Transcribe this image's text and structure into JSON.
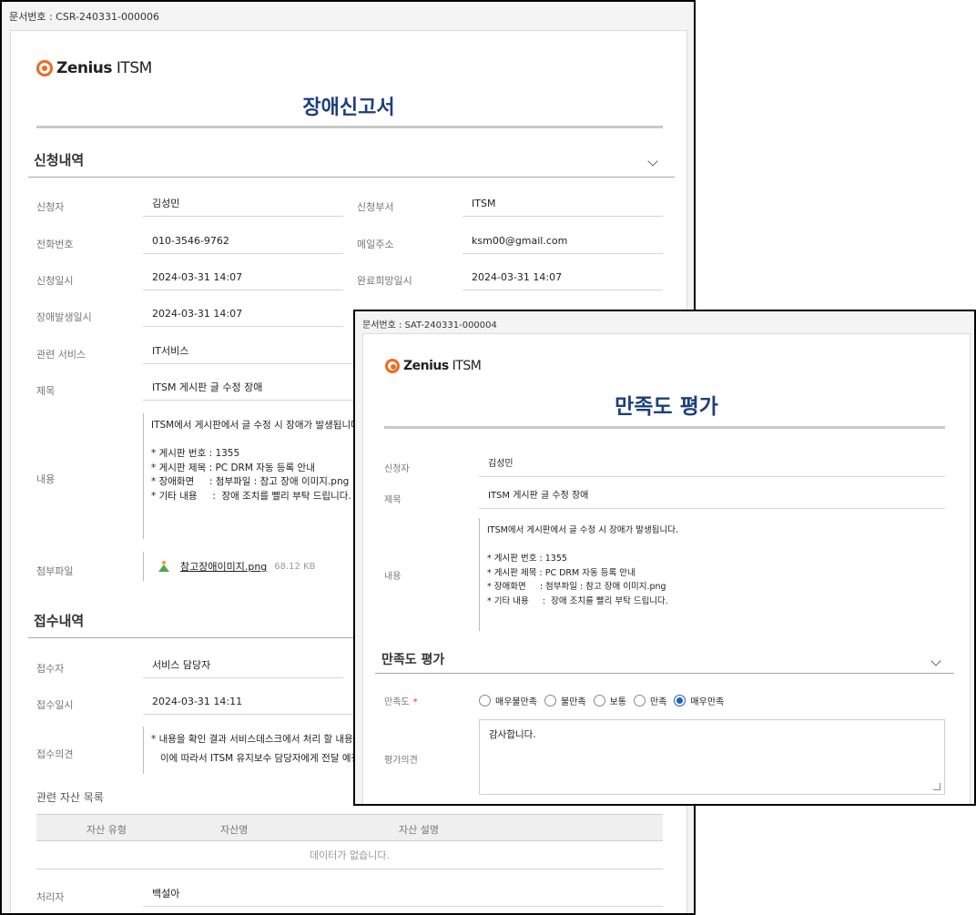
{
  "report": {
    "doc_no": "문서번호 : CSR-240331-000006",
    "logo": {
      "brand": "Zenius",
      "product": " ITSM"
    },
    "title": "장애신고서",
    "request_section": {
      "title": "신청내역",
      "requester_label": "신청자",
      "requester": "김성민",
      "dept_label": "신청부서",
      "dept": "ITSM",
      "phone_label": "전화번호",
      "phone": "010-3546-9762",
      "email_label": "메일주소",
      "email": "ksm00@gmail.com",
      "request_date_label": "신청일시",
      "request_date": "2024-03-31 14:07",
      "due_date_label": "완료희망일시",
      "due_date": "2024-03-31 14:07",
      "incident_date_label": "장애발생일시",
      "incident_date": "2024-03-31 14:07",
      "service_label": "관련 서비스",
      "service": "IT서비스",
      "subject_label": "제목",
      "subject": "ITSM 게시판 글 수정 장애",
      "content_label": "내용",
      "content": "ITSM에서 게시판에서 글 수정 시 장애가 발생됩니다.\n\n* 게시판 번호 : 1355\n* 게시판 제목 : PC DRM 자동 등록 안내\n* 장애화면     : 첨부파일 : 참고 장애 이미지.png\n* 기타 내용     :  장애 조치를 빨리 부탁 드립니다.",
      "attachment_label": "첨부파일",
      "attachment_name": "참고장애이미지.png",
      "attachment_size": "68.12 KB"
    },
    "receipt_section": {
      "title": "접수내역",
      "receiver_label": "접수자",
      "receiver": "서비스 담당자",
      "receipt_date_label": "접수일시",
      "receipt_date": "2024-03-31 14:11",
      "opinion_label": "접수의견",
      "opinion": "* 내용을 확인 결과 서비스데스크에서 처리 할 내용이\n   이에 따라서 ITSM 유지보수 담당자에게 전달 예정.",
      "assets_title": "관련 자산 목록",
      "asset_columns": [
        "자산 유형",
        "자산명",
        "자산 설명"
      ],
      "assets_empty": "데이터가 없습니다.",
      "handler_label": "처리자",
      "handler": "백설아"
    }
  },
  "survey": {
    "doc_no": "문서번호 : SAT-240331-000004",
    "logo": {
      "brand": "Zenius",
      "product": " ITSM"
    },
    "title": "만족도 평가",
    "requester_label": "신청자",
    "requester": "김성민",
    "subject_label": "제목",
    "subject": "ITSM 게시판 글 수정 장애",
    "content_label": "내용",
    "content": "ITSM에서 게시판에서 글 수정 시 장애가 발생됩니다.\n\n* 게시판 번호 : 1355\n* 게시판 제목 : PC DRM 자동 등록 안내\n* 장애화면     : 첨부파일 : 참고 장애 이미지.png\n* 기타 내용     :  장애 조치를 빨리 부탁 드립니다.",
    "eval_section": {
      "title": "만족도 평가",
      "rating_label": "만족도",
      "required_mark": "*",
      "options": [
        "매우불만족",
        "불만족",
        "보통",
        "만족",
        "매우만족"
      ],
      "selected": "매우만족",
      "opinion_label": "평가의견",
      "opinion": "감사합니다."
    }
  }
}
